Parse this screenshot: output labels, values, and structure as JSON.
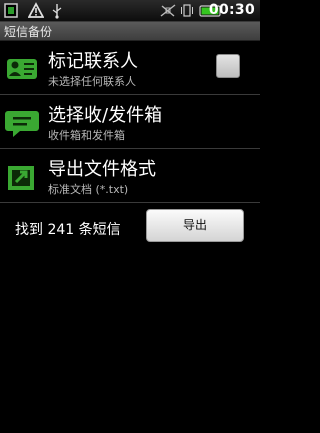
{
  "statusbar": {
    "time": "00:30",
    "icons": [
      "app-notification-icon",
      "warning-icon",
      "usb-icon",
      "signal-off-icon",
      "vibrate-icon",
      "battery-icon"
    ],
    "battery_color": "#35c520"
  },
  "titlebar": {
    "title": "短信备份"
  },
  "items": [
    {
      "title": "标记联系人",
      "subtitle": "未选择任何联系人",
      "icon": "contacts-icon",
      "checked": false
    },
    {
      "title": "选择收/发件箱",
      "subtitle": "收件箱和发件箱",
      "icon": "message-icon"
    },
    {
      "title": "导出文件格式",
      "subtitle": "标准文档 (*.txt)",
      "icon": "export-format-icon"
    }
  ],
  "footer": {
    "found_text": "找到 241 条短信",
    "export_label": "导出"
  },
  "colors": {
    "icon_green": "#3aa832",
    "background": "#000000"
  }
}
